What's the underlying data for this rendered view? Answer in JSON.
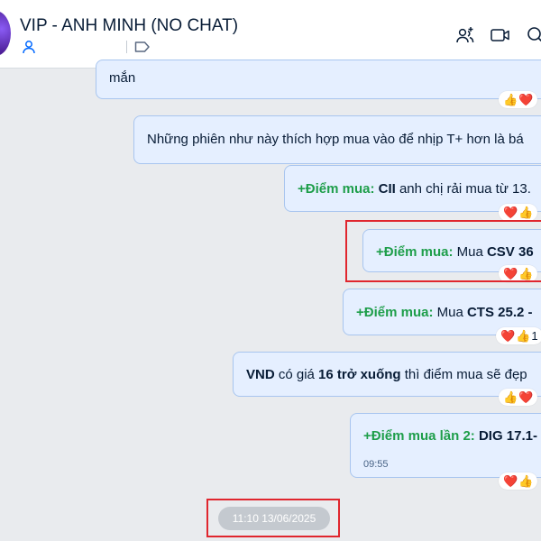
{
  "header": {
    "title": "VIP - ANH MINH (NO CHAT)",
    "icons": [
      "member-icon",
      "tag-icon",
      "add-user-icon",
      "video-call-icon",
      "search-icon"
    ]
  },
  "messages": [
    {
      "text": "mắn",
      "reactions": [
        "👍",
        "❤️"
      ]
    },
    {
      "text": "Những phiên như này thích hợp mua vào để nhịp T+ hơn là bá"
    },
    {
      "label": "+Điểm mua:",
      "bold": "CII",
      "rest": " anh chị rải mua từ 13.",
      "reactions": [
        "❤️",
        "👍"
      ]
    },
    {
      "label": "+Điểm mua:",
      "pre": " Mua ",
      "bold": "CSV 36",
      "reactions": [
        "❤️",
        "👍"
      ]
    },
    {
      "label": "+Điểm mua:",
      "pre": " Mua ",
      "bold": "CTS 25.2 -",
      "reactions": [
        "❤️",
        "👍",
        "1"
      ]
    },
    {
      "bold1": "VND",
      "mid": " có giá ",
      "bold2": "16 trở xuống",
      "rest": " thì điểm mua sẽ đẹp",
      "reactions": [
        "👍",
        "❤️"
      ]
    },
    {
      "label": "+Điểm mua lần 2:",
      "bold": " DIG 17.1-",
      "time": "09:55",
      "reactions": [
        "❤️",
        "👍"
      ]
    }
  ],
  "date_stamp": "11:10 13/06/2025",
  "colors": {
    "accent": "#0068ff",
    "label_green": "#1e9e4a",
    "bubble_bg": "#e5efff",
    "bubble_border": "#a8c5ef",
    "highlight_red": "#e0262e"
  }
}
